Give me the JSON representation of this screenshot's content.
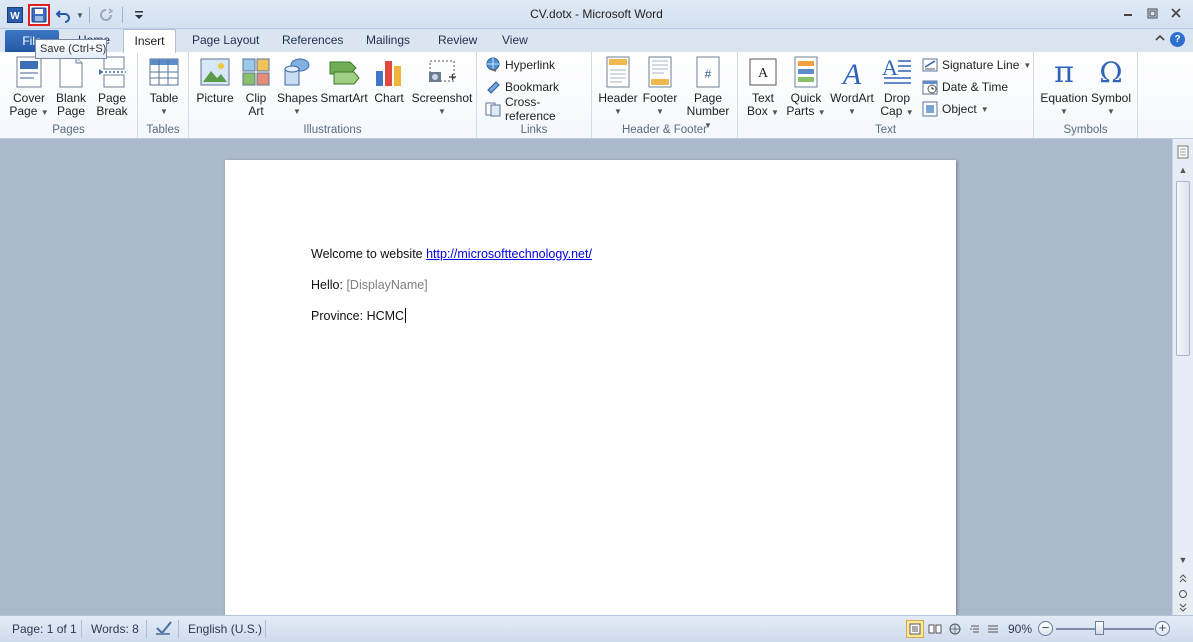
{
  "window": {
    "title": "CV.dotx - Microsoft Word",
    "tooltip": "Save (Ctrl+S)"
  },
  "tabs": {
    "file": "File",
    "home": "Home",
    "insert": "Insert",
    "page_layout": "Page Layout",
    "references": "References",
    "mailings": "Mailings",
    "review": "Review",
    "view": "View"
  },
  "ribbon": {
    "pages": {
      "label": "Pages",
      "cover": [
        "Cover",
        "Page"
      ],
      "blank": [
        "Blank",
        "Page"
      ],
      "break": [
        "Page",
        "Break"
      ]
    },
    "tables": {
      "label": "Tables",
      "table": "Table"
    },
    "illustrations": {
      "label": "Illustrations",
      "picture": "Picture",
      "clipart": [
        "Clip",
        "Art"
      ],
      "shapes": "Shapes",
      "smartart": "SmartArt",
      "chart": "Chart",
      "screenshot": "Screenshot"
    },
    "links": {
      "label": "Links",
      "hyperlink": "Hyperlink",
      "bookmark": "Bookmark",
      "crossref": "Cross-reference"
    },
    "header_footer": {
      "label": "Header & Footer",
      "header": "Header",
      "footer": "Footer",
      "page_number": [
        "Page",
        "Number"
      ]
    },
    "text": {
      "label": "Text",
      "textbox": [
        "Text",
        "Box"
      ],
      "quickparts": [
        "Quick",
        "Parts"
      ],
      "wordart": "WordArt",
      "dropcap": [
        "Drop",
        "Cap"
      ],
      "signature": "Signature Line",
      "datetime": "Date & Time",
      "object": "Object"
    },
    "symbols": {
      "label": "Symbols",
      "equation": "Equation",
      "symbol": "Symbol"
    }
  },
  "document": {
    "line1_text": "Welcome to website ",
    "line1_link": "http://microsofttechnology.net/",
    "line2_label": "Hello: ",
    "line2_field": "[DisplayName]",
    "line3": "Province: HCMC"
  },
  "status": {
    "page": "Page: 1 of 1",
    "words": "Words: 8",
    "language": "English (U.S.)",
    "zoom": "90%"
  },
  "colors": {
    "file_tab": "#2b62b0",
    "accent_red": "#e02020",
    "doc_background": "#abb9cc"
  }
}
